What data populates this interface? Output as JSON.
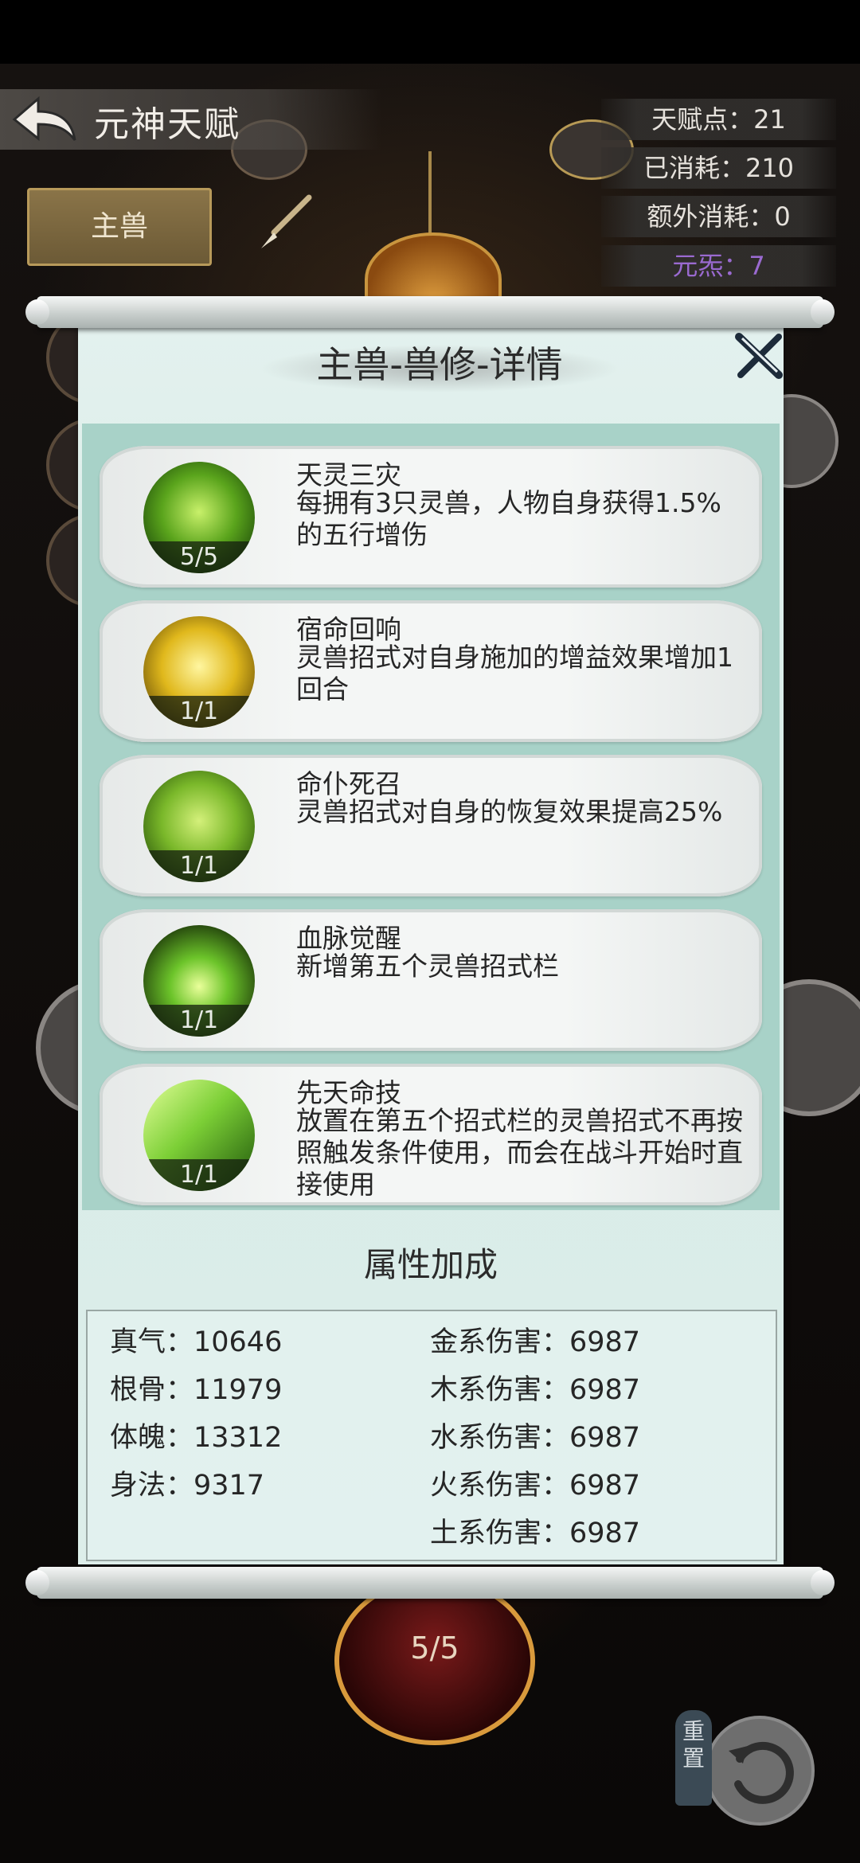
{
  "header": {
    "title": "元神天赋",
    "stats": [
      "天赋点：21",
      "已消耗：210",
      "额外消耗：0"
    ],
    "element_stat": "元炁：7",
    "tab_label": "主兽"
  },
  "background": {
    "bottom_node_level": "5/5"
  },
  "modal": {
    "title": "主兽-兽修-详情",
    "talents": [
      {
        "name": "天灵三灾",
        "desc": "每拥有3只灵兽，人物自身获得1.5%的五行增伤",
        "level": "5/5"
      },
      {
        "name": "宿命回响",
        "desc": "灵兽招式对自身施加的增益效果增加1回合",
        "level": "1/1"
      },
      {
        "name": "命仆死召",
        "desc": "灵兽招式对自身的恢复效果提高25%",
        "level": "1/1"
      },
      {
        "name": "血脉觉醒",
        "desc": "新增第五个灵兽招式栏",
        "level": "1/1"
      },
      {
        "name": "先天命技",
        "desc": "放置在第五个招式栏的灵兽招式不再按照触发条件使用，而会在战斗开始时直接使用",
        "level": "1/1"
      }
    ],
    "attr_section_title": "属性加成",
    "attributes_left": [
      "真气：10646",
      "根骨：11979",
      "体魄：13312",
      "身法：9317"
    ],
    "attributes_right": [
      "金系伤害：6987",
      "木系伤害：6987",
      "水系伤害：6987",
      "火系伤害：6987",
      "土系伤害：6987"
    ]
  },
  "footer": {
    "reset_label": "重置"
  },
  "colors": {
    "accent_gold": "#c9a55a",
    "element_purple": "#9a6ad0",
    "list_bg": "#a8d2c8"
  }
}
